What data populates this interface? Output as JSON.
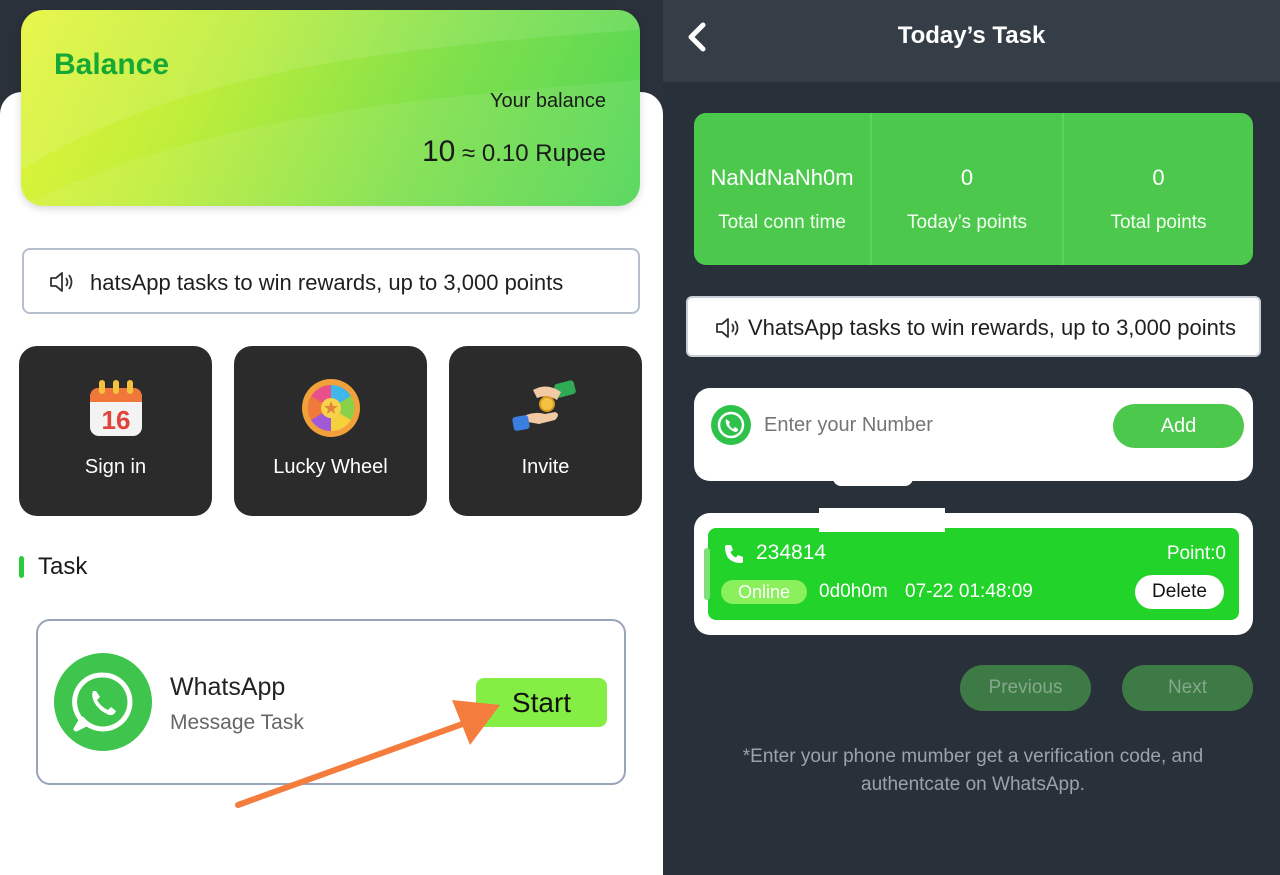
{
  "left": {
    "balance": {
      "title": "Balance",
      "label": "Your balance",
      "points": "10",
      "approx": "≈ 0.10 Rupee"
    },
    "notice": "hatsApp tasks to win rewards, up to 3,000 points",
    "tiles": [
      {
        "label": "Sign in",
        "icon": "calendar-icon",
        "icon_text": "16"
      },
      {
        "label": "Lucky Wheel",
        "icon": "wheel-icon"
      },
      {
        "label": "Invite",
        "icon": "handshake-coin-icon"
      }
    ],
    "section_title": "Task",
    "task": {
      "name": "WhatsApp",
      "subtitle": "Message Task",
      "button": "Start"
    },
    "colors": {
      "accent_green": "#15a834",
      "start_button": "#85ee45",
      "arrow": "#f47c3c"
    }
  },
  "right": {
    "title": "Today’s Task",
    "stats": [
      {
        "value": "NaNdNaNh0m",
        "label": "Total conn time"
      },
      {
        "value": "0",
        "label": "Today’s points"
      },
      {
        "value": "0",
        "label": "Total points"
      }
    ],
    "notice": "VhatsApp tasks to win rewards, up to 3,000 points",
    "add": {
      "placeholder": "Enter your Number",
      "button": "Add"
    },
    "account": {
      "number": "234814",
      "points": "Point:0",
      "status": "Online",
      "duration": "0d0h0m",
      "timestamp": "07-22 01:48:09",
      "delete": "Delete"
    },
    "pagination": {
      "previous": "Previous",
      "next": "Next"
    },
    "note": "*Enter your phone mumber get a verification code, and authentcate on WhatsApp.",
    "colors": {
      "background": "#283039",
      "stats_green": "#4cc84d",
      "account_green": "#22d32a"
    }
  }
}
